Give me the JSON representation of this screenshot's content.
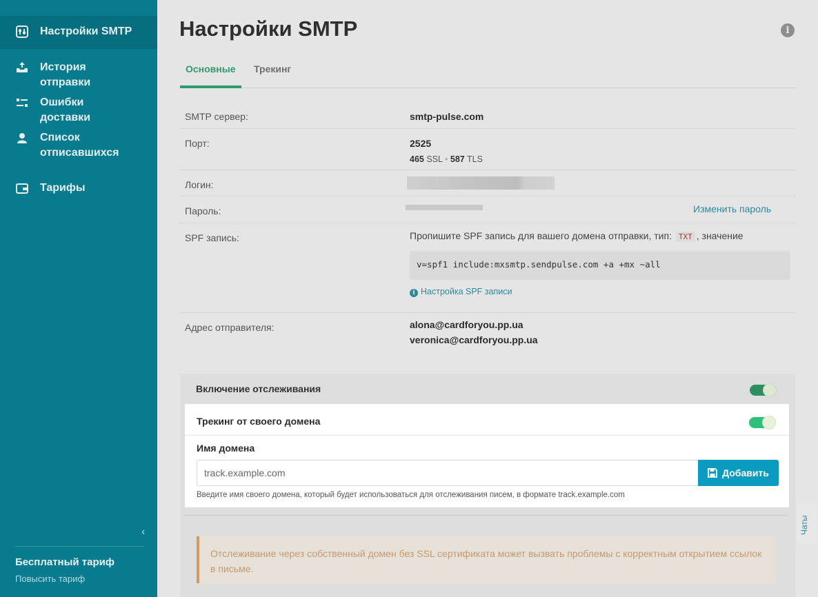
{
  "sidebar": {
    "items": [
      {
        "label": "Настройки SMTP",
        "icon": "sliders-icon"
      },
      {
        "label": "История отправки",
        "icon": "upload-tray-icon"
      },
      {
        "label": "Ошибки доставки",
        "icon": "tune-icon"
      },
      {
        "label": "Список отписавшихся",
        "icon": "user-icon"
      },
      {
        "label": "Тарифы",
        "icon": "wallet-icon"
      }
    ],
    "collapse_label": "‹",
    "plan_name": "Бесплатный тариф",
    "upgrade_label": "Повысить тариф"
  },
  "page": {
    "title": "Настройки SMTP",
    "info_label": "i"
  },
  "tabs": [
    {
      "label": "Основные",
      "active": true
    },
    {
      "label": "Трекинг",
      "active": false
    }
  ],
  "settings": {
    "server_label": "SMTP сервер:",
    "server_value": "smtp-pulse.com",
    "port_label": "Порт:",
    "port_value": "2525",
    "port_ssl": "465",
    "port_ssl_label": "SSL",
    "port_sep": "•",
    "port_tls": "587",
    "port_tls_label": "TLS",
    "login_label": "Логин:",
    "password_label": "Пароль:",
    "change_password": "Изменить пароль",
    "spf_label": "SPF запись:",
    "spf_text_before": "Пропишите SPF запись для вашего домена отправки, тип:",
    "spf_type": "TXT",
    "spf_text_after": ", значение",
    "spf_value": "v=spf1 include:mxsmtp.sendpulse.com +a +mx ~all",
    "spf_help_icon": "i",
    "spf_help": "Настройка SPF записи",
    "sender_label": "Адрес отправителя:",
    "senders": [
      "alona@cardforyou.pp.ua",
      "veronica@cardforyou.pp.ua"
    ]
  },
  "tracking": {
    "enable_label": "Включение отслеживания",
    "enable_on": true,
    "own_domain_label": "Трекинг от своего домена",
    "own_domain_on": true,
    "domain_name_label": "Имя домена",
    "domain_placeholder": "track.example.com",
    "add_button": "Добавить",
    "hint": "Введите имя своего домена, который будет использоваться для отслеживания писем, в формате track.example.com",
    "warning": "Отслеживание через собственный домен без SSL сертификата может вызвать проблемы с корректным открытием ссылок в письме."
  },
  "chat": {
    "label": "Чаты"
  },
  "colors": {
    "sidebar": "#087b8f",
    "accent_green": "#2f9a6a",
    "button_blue": "#0a9bbf",
    "warning_border": "#d49a5f"
  }
}
